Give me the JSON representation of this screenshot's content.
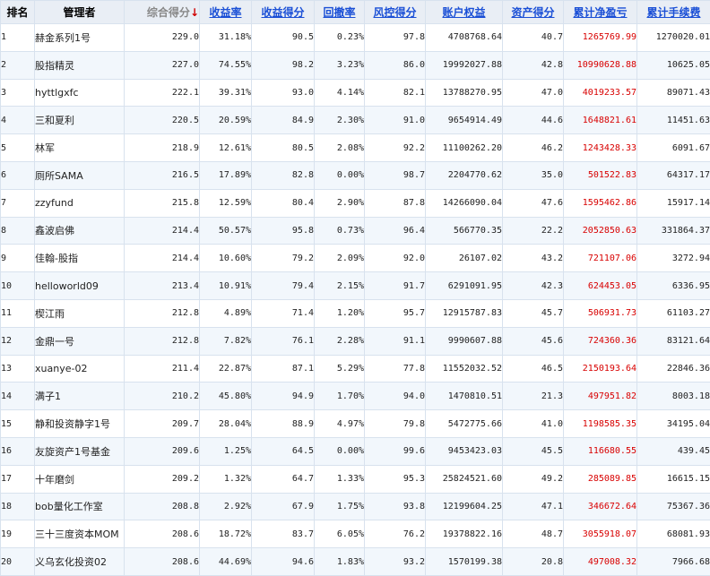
{
  "headers": {
    "rank": "排名",
    "manager": "管理者",
    "composite": "综合得分",
    "sort_arrow": "↓",
    "return_rate": "收益率",
    "return_score": "收益得分",
    "drawdown": "回撤率",
    "risk_score": "风控得分",
    "equity": "账户权益",
    "asset_score": "资产得分",
    "net_profit": "累计净盈亏",
    "fees": "累计手续费"
  },
  "rows": [
    {
      "rank": "1",
      "name": "赫金系列1号",
      "composite": "229.0",
      "return_rate": "31.18%",
      "return_score": "90.5",
      "drawdown": "0.23%",
      "risk_score": "97.8",
      "equity": "4708768.64",
      "asset_score": "40.7",
      "net_profit": "1265769.99",
      "fees": "1270020.01"
    },
    {
      "rank": "2",
      "name": "股指精灵",
      "composite": "227.0",
      "return_rate": "74.55%",
      "return_score": "98.2",
      "drawdown": "3.23%",
      "risk_score": "86.0",
      "equity": "19992027.88",
      "asset_score": "42.8",
      "net_profit": "10990628.88",
      "fees": "10625.05"
    },
    {
      "rank": "3",
      "name": "hyttlgxfc",
      "composite": "222.1",
      "return_rate": "39.31%",
      "return_score": "93.0",
      "drawdown": "4.14%",
      "risk_score": "82.1",
      "equity": "13788270.95",
      "asset_score": "47.0",
      "net_profit": "4019233.57",
      "fees": "89071.43"
    },
    {
      "rank": "4",
      "name": "三和夏利",
      "composite": "220.5",
      "return_rate": "20.59%",
      "return_score": "84.9",
      "drawdown": "2.30%",
      "risk_score": "91.0",
      "equity": "9654914.49",
      "asset_score": "44.6",
      "net_profit": "1648821.61",
      "fees": "11451.63"
    },
    {
      "rank": "5",
      "name": "林军",
      "composite": "218.9",
      "return_rate": "12.61%",
      "return_score": "80.5",
      "drawdown": "2.08%",
      "risk_score": "92.2",
      "equity": "11100262.20",
      "asset_score": "46.2",
      "net_profit": "1243428.33",
      "fees": "6091.67"
    },
    {
      "rank": "6",
      "name": "厕所SAMA",
      "composite": "216.5",
      "return_rate": "17.89%",
      "return_score": "82.8",
      "drawdown": "0.00%",
      "risk_score": "98.7",
      "equity": "2204770.62",
      "asset_score": "35.0",
      "net_profit": "501522.83",
      "fees": "64317.17"
    },
    {
      "rank": "7",
      "name": "zzyfund",
      "composite": "215.8",
      "return_rate": "12.59%",
      "return_score": "80.4",
      "drawdown": "2.90%",
      "risk_score": "87.8",
      "equity": "14266090.04",
      "asset_score": "47.6",
      "net_profit": "1595462.86",
      "fees": "15917.14"
    },
    {
      "rank": "8",
      "name": "鑫波启佛",
      "composite": "214.4",
      "return_rate": "50.57%",
      "return_score": "95.8",
      "drawdown": "0.73%",
      "risk_score": "96.4",
      "equity": "566770.35",
      "asset_score": "22.2",
      "net_profit": "2052850.63",
      "fees": "331864.37"
    },
    {
      "rank": "9",
      "name": "佳翰-股指",
      "composite": "214.4",
      "return_rate": "10.60%",
      "return_score": "79.2",
      "drawdown": "2.09%",
      "risk_score": "92.0",
      "equity": "26107.02",
      "asset_score": "43.2",
      "net_profit": "721107.06",
      "fees": "3272.94"
    },
    {
      "rank": "10",
      "name": "helloworld09",
      "composite": "213.4",
      "return_rate": "10.91%",
      "return_score": "79.4",
      "drawdown": "2.15%",
      "risk_score": "91.7",
      "equity": "6291091.95",
      "asset_score": "42.3",
      "net_profit": "624453.05",
      "fees": "6336.95"
    },
    {
      "rank": "11",
      "name": "楔江雨",
      "composite": "212.8",
      "return_rate": "4.89%",
      "return_score": "71.4",
      "drawdown": "1.20%",
      "risk_score": "95.7",
      "equity": "12915787.83",
      "asset_score": "45.7",
      "net_profit": "506931.73",
      "fees": "61103.27"
    },
    {
      "rank": "12",
      "name": "金鼎一号",
      "composite": "212.8",
      "return_rate": "7.82%",
      "return_score": "76.1",
      "drawdown": "2.28%",
      "risk_score": "91.1",
      "equity": "9990607.88",
      "asset_score": "45.6",
      "net_profit": "724360.36",
      "fees": "83121.64"
    },
    {
      "rank": "13",
      "name": "xuanye-02",
      "composite": "211.4",
      "return_rate": "22.87%",
      "return_score": "87.1",
      "drawdown": "5.29%",
      "risk_score": "77.8",
      "equity": "11552032.52",
      "asset_score": "46.5",
      "net_profit": "2150193.64",
      "fees": "22846.36"
    },
    {
      "rank": "14",
      "name": "满子1",
      "composite": "210.2",
      "return_rate": "45.80%",
      "return_score": "94.9",
      "drawdown": "1.70%",
      "risk_score": "94.0",
      "equity": "1470810.51",
      "asset_score": "21.3",
      "net_profit": "497951.82",
      "fees": "8003.18"
    },
    {
      "rank": "15",
      "name": "静和投资静字1号",
      "composite": "209.7",
      "return_rate": "28.04%",
      "return_score": "88.9",
      "drawdown": "4.97%",
      "risk_score": "79.8",
      "equity": "5472775.66",
      "asset_score": "41.0",
      "net_profit": "1198585.35",
      "fees": "34195.04"
    },
    {
      "rank": "16",
      "name": "友旋资产1号基金",
      "composite": "209.6",
      "return_rate": "1.25%",
      "return_score": "64.5",
      "drawdown": "0.00%",
      "risk_score": "99.6",
      "equity": "9453423.03",
      "asset_score": "45.5",
      "net_profit": "116680.55",
      "fees": "439.45"
    },
    {
      "rank": "17",
      "name": "十年磨剑",
      "composite": "209.2",
      "return_rate": "1.32%",
      "return_score": "64.7",
      "drawdown": "1.33%",
      "risk_score": "95.3",
      "equity": "25824521.60",
      "asset_score": "49.2",
      "net_profit": "285089.85",
      "fees": "16615.15"
    },
    {
      "rank": "18",
      "name": "bob量化工作室",
      "composite": "208.8",
      "return_rate": "2.92%",
      "return_score": "67.9",
      "drawdown": "1.75%",
      "risk_score": "93.8",
      "equity": "12199604.25",
      "asset_score": "47.1",
      "net_profit": "346672.64",
      "fees": "75367.36"
    },
    {
      "rank": "19",
      "name": "三十三度资本MOM",
      "composite": "208.6",
      "return_rate": "18.72%",
      "return_score": "83.7",
      "drawdown": "6.05%",
      "risk_score": "76.2",
      "equity": "19378822.16",
      "asset_score": "48.7",
      "net_profit": "3055918.07",
      "fees": "68081.93"
    },
    {
      "rank": "20",
      "name": "义乌玄化投资02",
      "composite": "208.6",
      "return_rate": "44.69%",
      "return_score": "94.6",
      "drawdown": "1.83%",
      "risk_score": "93.2",
      "equity": "1570199.38",
      "asset_score": "20.8",
      "net_profit": "497008.32",
      "fees": "7966.68"
    }
  ],
  "colors": {
    "header_bg": "#e9eef5",
    "header_link": "#1a4fd6",
    "profit_red": "#d80000",
    "row_alt_bg": "#f2f7fc",
    "border": "#d8e2ee"
  }
}
